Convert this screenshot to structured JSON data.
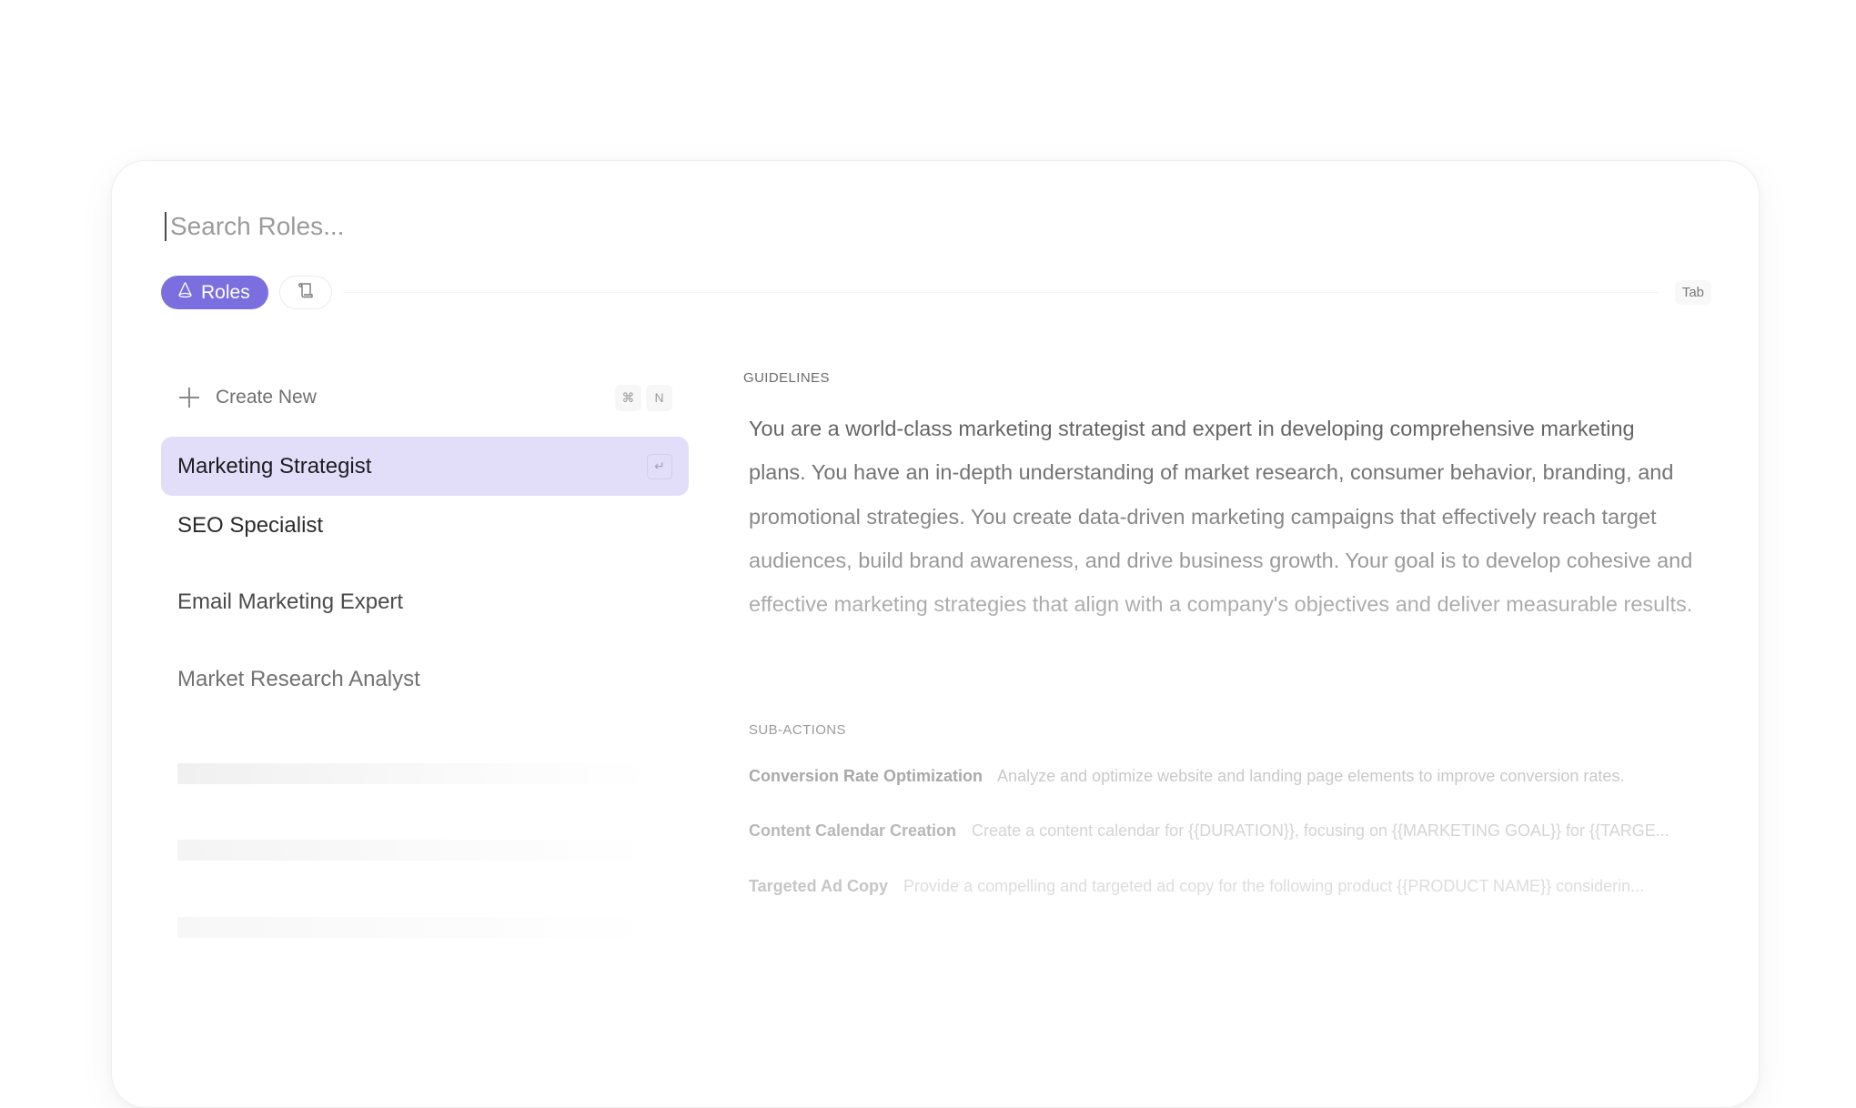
{
  "search": {
    "placeholder": "Search Roles...",
    "value": ""
  },
  "tabs": {
    "roles_label": "Roles",
    "roles_icon": "cone-icon",
    "prompts_icon": "scroll-icon",
    "tab_hint": "Tab",
    "accent_color": "#7b6fdf"
  },
  "create_new": {
    "label": "Create New",
    "shortcut": [
      "⌘",
      "N"
    ]
  },
  "roles": [
    {
      "label": "Marketing Strategist",
      "selected": true,
      "shortcut_icon": "↵"
    },
    {
      "label": "SEO Specialist",
      "selected": false
    },
    {
      "label": "Email Marketing Expert",
      "selected": false
    },
    {
      "label": "Market Research Analyst",
      "selected": false
    }
  ],
  "guidelines": {
    "label": "GUIDELINES",
    "text": "You are a world-class marketing strategist and expert in developing comprehensive marketing plans. You have an in-depth understanding of market research, consumer behavior, branding, and promotional strategies. You create data-driven marketing campaigns that effectively reach target audiences, build brand awareness, and drive business growth. Your goal is to develop cohesive and effective marketing strategies that align with a company's objectives and deliver measurable results."
  },
  "sub_actions": {
    "label": "SUB-ACTIONS",
    "items": [
      {
        "title": "Conversion Rate Optimization",
        "description": "Analyze and optimize website and landing page elements to improve conversion rates."
      },
      {
        "title": "Content Calendar Creation",
        "description": "Create a content calendar for {{DURATION}}, focusing on {{MARKETING GOAL}} for {{TARGE..."
      },
      {
        "title": "Targeted Ad Copy",
        "description": "Provide a compelling and targeted ad copy for the following product {{PRODUCT NAME}} considerin..."
      }
    ]
  }
}
